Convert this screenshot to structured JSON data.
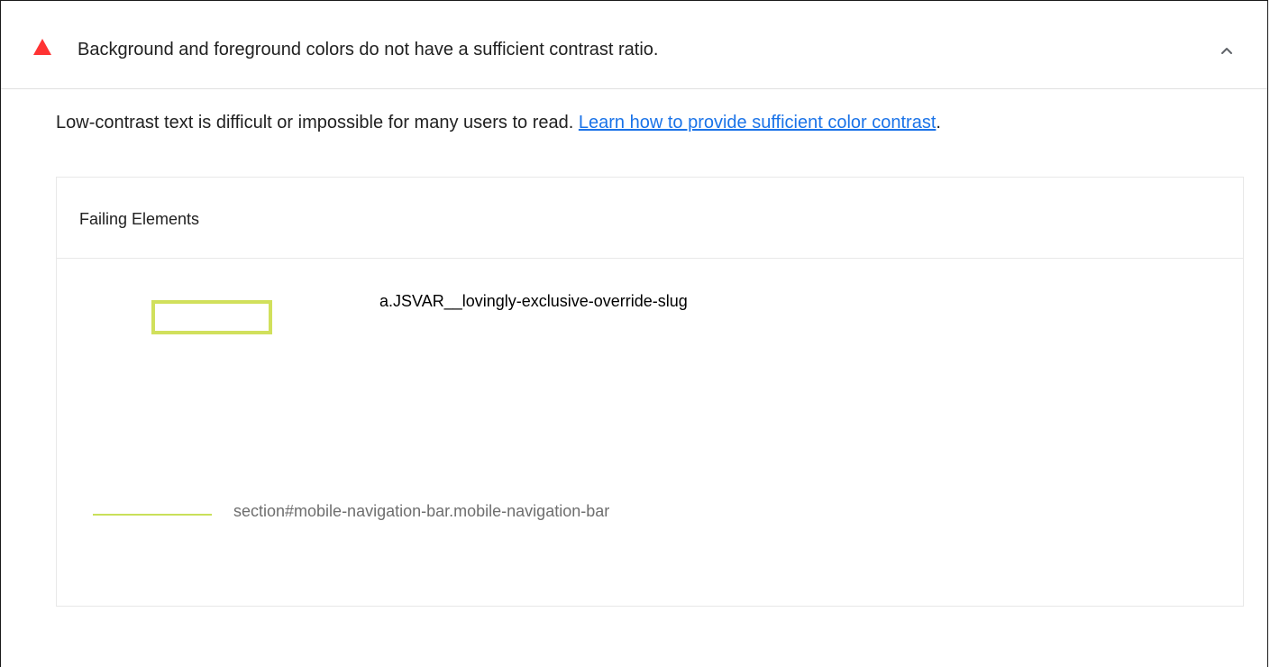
{
  "audit": {
    "status_icon": "warning-triangle-icon",
    "status_color": "#ff3333",
    "title": "Background and foreground colors do not have a sufficient contrast ratio.",
    "expand_icon": "chevron-up-icon",
    "description_text": "Low-contrast text is difficult or impossible for many users to read. ",
    "description_link": "Learn how to provide sufficient color contrast",
    "description_suffix": ".",
    "link_color": "#1a73e8"
  },
  "details": {
    "column_header": "Failing Elements",
    "items": [
      {
        "selector": "a.JSVAR__lovingly-exclusive-override-slug",
        "thumbnail_color": "#d1e05c"
      },
      {
        "selector": "section#mobile-navigation-bar.mobile-navigation-bar",
        "thumbnail_color": "#c9e05a"
      }
    ]
  }
}
